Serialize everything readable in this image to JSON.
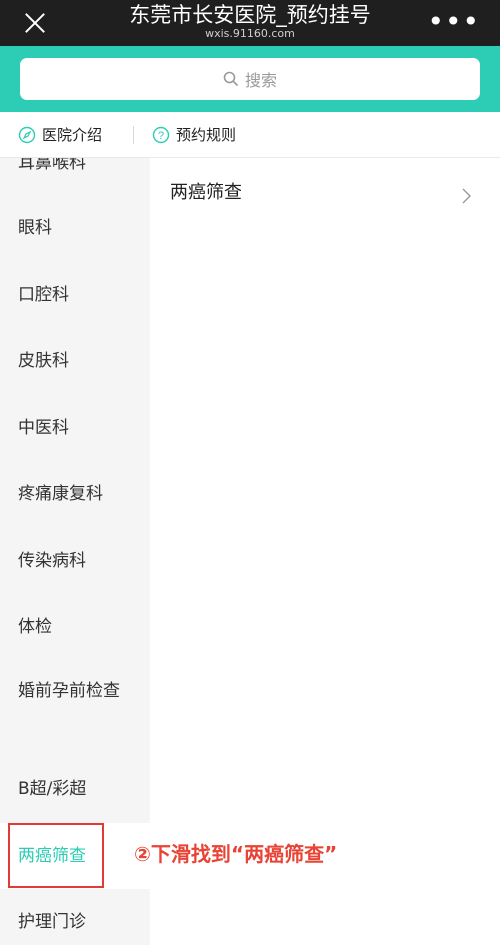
{
  "header": {
    "title": "东莞市长安医院_预约挂号",
    "subtitle": "wxis.91160.com",
    "more_label": "•••"
  },
  "search": {
    "placeholder": "搜索"
  },
  "infobar": {
    "left_label": "医院介绍",
    "right_label": "预约规则",
    "left_icon": "compass-icon",
    "right_icon": "question-icon"
  },
  "sidebar": {
    "items": [
      {
        "label": "耳鼻喉科"
      },
      {
        "label": "眼科"
      },
      {
        "label": "口腔科"
      },
      {
        "label": "皮肤科"
      },
      {
        "label": "中医科"
      },
      {
        "label": "疼痛康复科"
      },
      {
        "label": "传染病科"
      },
      {
        "label": "体检"
      },
      {
        "label": "婚前孕前检查"
      },
      {
        "label": "B超/彩超"
      },
      {
        "label": "两癌筛查"
      },
      {
        "label": "护理门诊"
      }
    ],
    "active_label": "两癌筛查"
  },
  "main": {
    "rows": [
      {
        "label": "两癌筛查"
      }
    ]
  },
  "annotation": {
    "text": "②下滑找到“两癌筛查”"
  },
  "colors": {
    "accent": "#2ccdb4",
    "header_bg": "#1f1f1f",
    "annotation_red": "#e84335"
  }
}
